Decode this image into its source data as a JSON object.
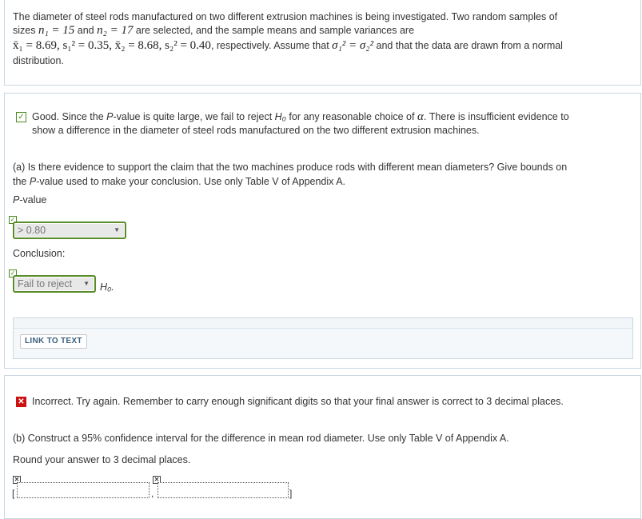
{
  "intro": {
    "line1": "The diameter of steel rods manufactured on two different extrusion machines is being investigated. Two random samples of",
    "sizes_prefix": "sizes ",
    "n1": "n₁ = 15",
    "and": " and ",
    "n2": "n₂ = 17",
    "sizes_suffix": " are selected, and the sample means and sample variances are",
    "stats": "x̄₁ = 8.69, s₁² = 0.35, x̄₂ = 8.68, s₂² = 0.40",
    "assume": ", respectively. Assume that ",
    "equal_var": "σ₁² = σ₂²",
    "assume_suffix": " and that the data are drawn from a normal",
    "line4": "distribution."
  },
  "part_a": {
    "feedback_text_1": "Good. Since the ",
    "feedback_p": "P",
    "feedback_text_2": "-value is quite large, we fail to reject ",
    "feedback_h0": "H₀",
    "feedback_text_3": " for any reasonable choice of ",
    "feedback_alpha": "α",
    "feedback_text_4": ". There is insufficient evidence to",
    "feedback_line2": "show a difference in the diameter of steel rods manufactured on the two different extrusion machines.",
    "question_1": "(a) Is there evidence to support the claim that the two machines produce rods with different mean diameters? Give bounds on",
    "question_2a": "the ",
    "question_2p": "P",
    "question_2b": "-value used to make your conclusion. Use only Table V of Appendix A.",
    "pvalue_label_p": "P",
    "pvalue_label_rest": "-value",
    "pvalue_selected": "> 0.80",
    "conclusion_label": "Conclusion:",
    "conclusion_selected": "Fail to reject",
    "h0_suffix": "H₀.",
    "link_button": "LINK TO TEXT"
  },
  "part_b": {
    "feedback": "Incorrect. Try again. Remember to carry enough significant digits so that your final answer is correct to 3 decimal places.",
    "question": "(b) Construct a 95% confidence interval for the difference in mean rod diameter. Use only Table V of Appendix A.",
    "round": "Round your answer to 3 decimal places.",
    "bracket_open": "[",
    "comma": ",",
    "bracket_close": "]",
    "lower_value": "",
    "upper_value": ""
  },
  "colors": {
    "correct": "#4b8b1d",
    "incorrect": "#cc1111",
    "border": "#c9d7e3"
  },
  "icons": {
    "correct": "check-icon",
    "incorrect": "x-icon",
    "dropdown": "triangle-down-icon"
  }
}
